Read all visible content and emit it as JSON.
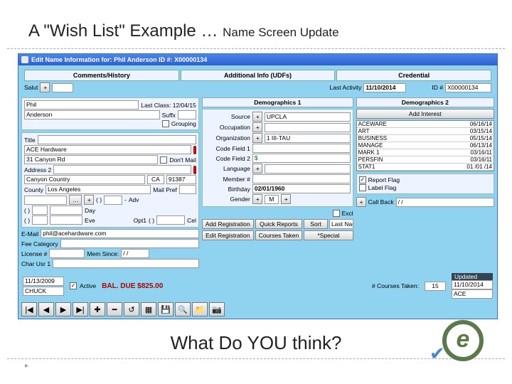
{
  "slide": {
    "title_main": "A \"Wish List\" Example … ",
    "title_sub": "Name Screen Update",
    "footer_q": "What Do YOU think?"
  },
  "titlebar": "Edit Name Information for: Phil Anderson ID #: X00000134",
  "tabs_top": {
    "a": "Comments/History",
    "b": "Additional Info (UDFs)",
    "c": "Credential"
  },
  "header": {
    "salut_label": "Salut",
    "last_activity_label": "Last Activity",
    "last_activity_value": "11/10/2014",
    "id_label": "ID #",
    "id_value": "X00000134"
  },
  "name": {
    "first": "Phil",
    "last": "Anderson",
    "last_class_label": "Last Class: 12/04/15",
    "suffx_label": "Suffx",
    "grouping_label": "Grouping"
  },
  "addr": {
    "title_label": "Title",
    "firm": "ACE Hardware",
    "street": "31 Canyon Rd",
    "addr2_label": "Address 2",
    "city": "Canyon Country",
    "state": "CA",
    "zip": "91387",
    "county_label": "County",
    "county": "Los Angeles",
    "country_placeholder": "Country",
    "dont_mail_label": "Don't Mail",
    "mail_pref_label": "Mail Pref"
  },
  "phones": {
    "day": "Day",
    "eve": "Eve",
    "adv": "Adv",
    "cel": "Cel",
    "opt1": "Opt1",
    "lp": "(   )",
    "dash": "-"
  },
  "email": {
    "label": "E-Mail",
    "value": "phil@acehardware.com"
  },
  "fee_cat_label": "Fee Category",
  "license": {
    "label": "License #",
    "mem_since_label": "Mem Since:",
    "mem_since_value": "/  /"
  },
  "char_usr1_label": "Char Usr 1",
  "demo_tabs": {
    "d1": "Demographics 1",
    "d2": "Demographics 2"
  },
  "demo": {
    "source_label": "Source",
    "source_value": "UPCLA",
    "occupation_label": "Occupation",
    "organization_label": "Organization",
    "organization_value": "1  III-TAU",
    "code1_label": "Code Field 1",
    "code2_label": "Code Field 2",
    "code2_value": "$",
    "language_label": "Language",
    "member_label": "Member #",
    "birthday_label": "Birthday",
    "birthday_value": "02/01/1960",
    "gender_label": "Gender",
    "gender_value": "M"
  },
  "interest": {
    "button": "Add Interest",
    "rows": [
      {
        "c": "ACEWARE",
        "d": "06/16/14"
      },
      {
        "c": "ART",
        "d": "03/15/14"
      },
      {
        "c": "BUSINESS",
        "d": "05/15/14"
      },
      {
        "c": "MANAGE",
        "d": "06/13/14"
      },
      {
        "c": "MARK 1",
        "d": "03/16/11"
      },
      {
        "c": "PERSFIN",
        "d": "03/16/11"
      },
      {
        "c": "STAT1",
        "d": "01 /01 /14"
      }
    ]
  },
  "flags": {
    "report": "Report Flag",
    "label": "Label Flag",
    "chk": "✓"
  },
  "excl": "Excl",
  "callback_label": "Call Back",
  "callback_value": "/  /",
  "mid_buttons": {
    "add_reg": "Add Registration",
    "quick_rep": "Quick Reports",
    "sort": "Sort",
    "sort_val": "Last Name, Fir",
    "edit_reg": "Edit Registration",
    "courses": "Courses Taken",
    "special": "*Special"
  },
  "footer": {
    "date_left": "11/13/2009",
    "user": "CHUCK",
    "active_label": "Active",
    "balance": "BAL. DUE $825.00",
    "courses_label": "# Courses Taken:",
    "courses_count": "15",
    "updated_label": "Updated",
    "updated_date": "11/10/2014",
    "updated_user": "ACE"
  },
  "icons": {
    "first": "|◀",
    "prev": "◀",
    "next": "▶",
    "last": "▶|",
    "plus": "✚",
    "minus": "━",
    "undo": "↺",
    "grid": "▦",
    "save": "💾",
    "search": "🔍",
    "folder": "📁",
    "photo": "📷"
  }
}
